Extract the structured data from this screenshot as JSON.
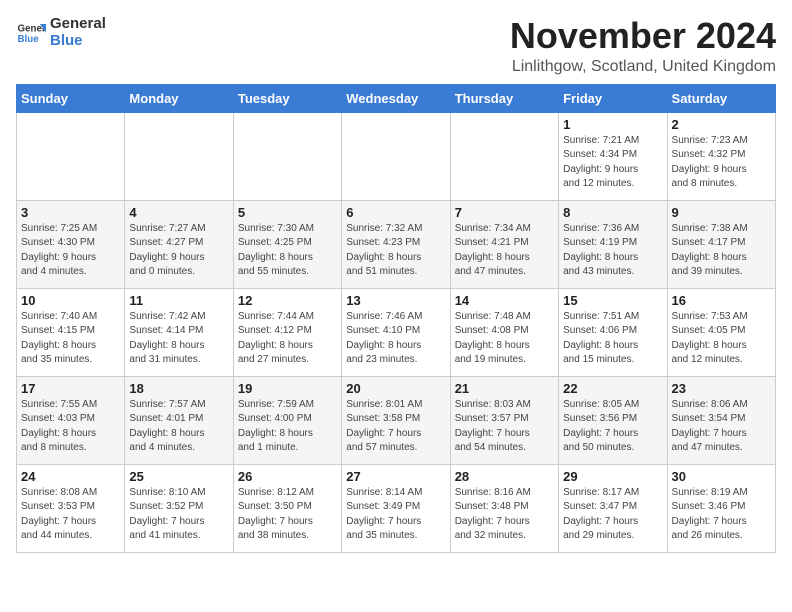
{
  "header": {
    "logo_general": "General",
    "logo_blue": "Blue",
    "month_title": "November 2024",
    "location": "Linlithgow, Scotland, United Kingdom"
  },
  "columns": [
    "Sunday",
    "Monday",
    "Tuesday",
    "Wednesday",
    "Thursday",
    "Friday",
    "Saturday"
  ],
  "rows": [
    [
      {
        "day": "",
        "info": ""
      },
      {
        "day": "",
        "info": ""
      },
      {
        "day": "",
        "info": ""
      },
      {
        "day": "",
        "info": ""
      },
      {
        "day": "",
        "info": ""
      },
      {
        "day": "1",
        "info": "Sunrise: 7:21 AM\nSunset: 4:34 PM\nDaylight: 9 hours\nand 12 minutes."
      },
      {
        "day": "2",
        "info": "Sunrise: 7:23 AM\nSunset: 4:32 PM\nDaylight: 9 hours\nand 8 minutes."
      }
    ],
    [
      {
        "day": "3",
        "info": "Sunrise: 7:25 AM\nSunset: 4:30 PM\nDaylight: 9 hours\nand 4 minutes."
      },
      {
        "day": "4",
        "info": "Sunrise: 7:27 AM\nSunset: 4:27 PM\nDaylight: 9 hours\nand 0 minutes."
      },
      {
        "day": "5",
        "info": "Sunrise: 7:30 AM\nSunset: 4:25 PM\nDaylight: 8 hours\nand 55 minutes."
      },
      {
        "day": "6",
        "info": "Sunrise: 7:32 AM\nSunset: 4:23 PM\nDaylight: 8 hours\nand 51 minutes."
      },
      {
        "day": "7",
        "info": "Sunrise: 7:34 AM\nSunset: 4:21 PM\nDaylight: 8 hours\nand 47 minutes."
      },
      {
        "day": "8",
        "info": "Sunrise: 7:36 AM\nSunset: 4:19 PM\nDaylight: 8 hours\nand 43 minutes."
      },
      {
        "day": "9",
        "info": "Sunrise: 7:38 AM\nSunset: 4:17 PM\nDaylight: 8 hours\nand 39 minutes."
      }
    ],
    [
      {
        "day": "10",
        "info": "Sunrise: 7:40 AM\nSunset: 4:15 PM\nDaylight: 8 hours\nand 35 minutes."
      },
      {
        "day": "11",
        "info": "Sunrise: 7:42 AM\nSunset: 4:14 PM\nDaylight: 8 hours\nand 31 minutes."
      },
      {
        "day": "12",
        "info": "Sunrise: 7:44 AM\nSunset: 4:12 PM\nDaylight: 8 hours\nand 27 minutes."
      },
      {
        "day": "13",
        "info": "Sunrise: 7:46 AM\nSunset: 4:10 PM\nDaylight: 8 hours\nand 23 minutes."
      },
      {
        "day": "14",
        "info": "Sunrise: 7:48 AM\nSunset: 4:08 PM\nDaylight: 8 hours\nand 19 minutes."
      },
      {
        "day": "15",
        "info": "Sunrise: 7:51 AM\nSunset: 4:06 PM\nDaylight: 8 hours\nand 15 minutes."
      },
      {
        "day": "16",
        "info": "Sunrise: 7:53 AM\nSunset: 4:05 PM\nDaylight: 8 hours\nand 12 minutes."
      }
    ],
    [
      {
        "day": "17",
        "info": "Sunrise: 7:55 AM\nSunset: 4:03 PM\nDaylight: 8 hours\nand 8 minutes."
      },
      {
        "day": "18",
        "info": "Sunrise: 7:57 AM\nSunset: 4:01 PM\nDaylight: 8 hours\nand 4 minutes."
      },
      {
        "day": "19",
        "info": "Sunrise: 7:59 AM\nSunset: 4:00 PM\nDaylight: 8 hours\nand 1 minute."
      },
      {
        "day": "20",
        "info": "Sunrise: 8:01 AM\nSunset: 3:58 PM\nDaylight: 7 hours\nand 57 minutes."
      },
      {
        "day": "21",
        "info": "Sunrise: 8:03 AM\nSunset: 3:57 PM\nDaylight: 7 hours\nand 54 minutes."
      },
      {
        "day": "22",
        "info": "Sunrise: 8:05 AM\nSunset: 3:56 PM\nDaylight: 7 hours\nand 50 minutes."
      },
      {
        "day": "23",
        "info": "Sunrise: 8:06 AM\nSunset: 3:54 PM\nDaylight: 7 hours\nand 47 minutes."
      }
    ],
    [
      {
        "day": "24",
        "info": "Sunrise: 8:08 AM\nSunset: 3:53 PM\nDaylight: 7 hours\nand 44 minutes."
      },
      {
        "day": "25",
        "info": "Sunrise: 8:10 AM\nSunset: 3:52 PM\nDaylight: 7 hours\nand 41 minutes."
      },
      {
        "day": "26",
        "info": "Sunrise: 8:12 AM\nSunset: 3:50 PM\nDaylight: 7 hours\nand 38 minutes."
      },
      {
        "day": "27",
        "info": "Sunrise: 8:14 AM\nSunset: 3:49 PM\nDaylight: 7 hours\nand 35 minutes."
      },
      {
        "day": "28",
        "info": "Sunrise: 8:16 AM\nSunset: 3:48 PM\nDaylight: 7 hours\nand 32 minutes."
      },
      {
        "day": "29",
        "info": "Sunrise: 8:17 AM\nSunset: 3:47 PM\nDaylight: 7 hours\nand 29 minutes."
      },
      {
        "day": "30",
        "info": "Sunrise: 8:19 AM\nSunset: 3:46 PM\nDaylight: 7 hours\nand 26 minutes."
      }
    ]
  ]
}
